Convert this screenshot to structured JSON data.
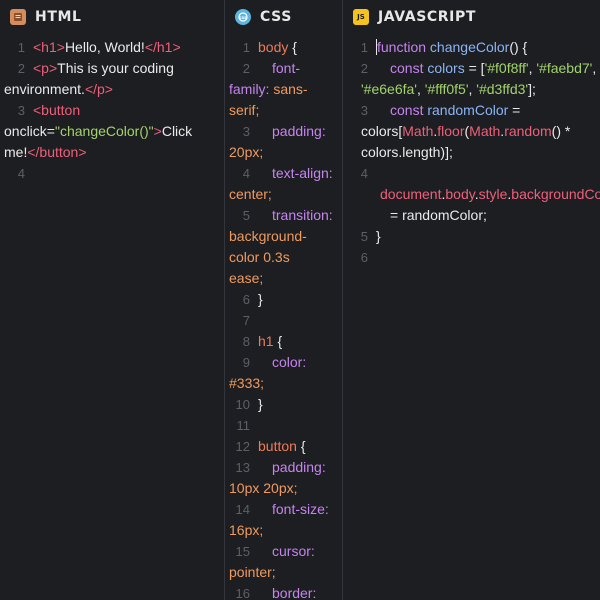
{
  "panels": {
    "html": {
      "title": "HTML",
      "icon": "html-file-icon"
    },
    "css": {
      "title": "CSS",
      "icon": "css-file-icon"
    },
    "js": {
      "title": "JAVASCRIPT",
      "icon": "js-file-icon",
      "badge": "JS"
    }
  },
  "html_code": {
    "line_numbers": [
      "1",
      "2",
      "3",
      "4"
    ],
    "l1": [
      "<h1>",
      "Hello, World!",
      "</h1>"
    ],
    "l2a": [
      "<p>",
      "This is your coding"
    ],
    "l2b": [
      "environment.",
      "</p>"
    ],
    "l3a": "<button",
    "l3b": [
      "onclick",
      "=",
      "\"changeColor()\"",
      ">",
      "Click"
    ],
    "l3c": [
      "me!",
      "</button>"
    ]
  },
  "css_code": {
    "line_numbers": [
      "1",
      "2",
      "3",
      "4",
      "5",
      "6",
      "7",
      "8",
      "9",
      "10",
      "11",
      "12",
      "13",
      "14",
      "15",
      "16"
    ],
    "rows": [
      [
        "body",
        " {"
      ],
      [
        "font-"
      ],
      [
        "family:",
        " sans-"
      ],
      [
        "serif;"
      ],
      [
        "padding:"
      ],
      [
        "20px;"
      ],
      [
        "text-align:"
      ],
      [
        "center;"
      ],
      [
        "transition:"
      ],
      [
        "background-"
      ],
      [
        "color 0.3s"
      ],
      [
        "ease;"
      ],
      [
        "}"
      ],
      [
        ""
      ],
      [
        "h1",
        " {"
      ],
      [
        "color:"
      ],
      [
        "#333;"
      ],
      [
        "}"
      ],
      [
        ""
      ],
      [
        "button",
        " {"
      ],
      [
        "padding:"
      ],
      [
        "10px 20px;"
      ],
      [
        "font-size:"
      ],
      [
        "16px;"
      ],
      [
        "cursor:"
      ],
      [
        "pointer;"
      ],
      [
        "border:"
      ]
    ]
  },
  "js_code": {
    "line_numbers": [
      "1",
      "2",
      "3",
      "4",
      "5",
      "6"
    ],
    "l1": [
      "function",
      " changeColor",
      "() {"
    ],
    "l2a": [
      "const",
      " colors",
      " = [",
      "'#f0f8ff'",
      ", ",
      "'#faebd7'",
      ","
    ],
    "l2b": [
      "'#e6e6fa'",
      ", ",
      "'#fff0f5'",
      ", ",
      "'#d3ffd3'",
      "];"
    ],
    "l3a": [
      "const",
      " randomColor",
      " ="
    ],
    "l3b": [
      "colors",
      "[",
      "Math",
      ".",
      "floor",
      "(",
      "Math",
      ".",
      "random",
      "() *"
    ],
    "l3c": [
      "colors",
      ".",
      "length",
      ")];"
    ],
    "l4": [
      "document",
      ".",
      "body",
      ".",
      "style",
      ".",
      "backgroundColor"
    ],
    "l4b": [
      "= randomColor;"
    ],
    "l5": "}"
  }
}
